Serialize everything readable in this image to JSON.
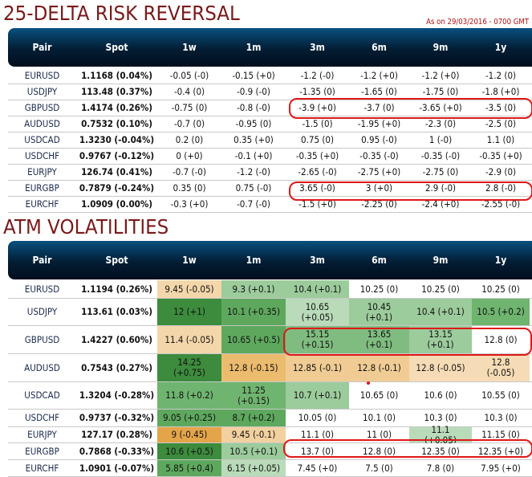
{
  "risk_reversal": {
    "title": "25-DELTA RISK REVERSAL",
    "as_of": "As on 29/03/2016 - 0700 GMT",
    "columns": [
      "Pair",
      "Spot",
      "1w",
      "1m",
      "3m",
      "6m",
      "9m",
      "1y"
    ],
    "rows": [
      [
        "EURUSD",
        "1.1168 (0.04%)",
        "-0.05 (-0)",
        "-0.15 (+0)",
        "-1.2 (-0)",
        "-1.2 (+0)",
        "-1.2 (+0)",
        "-1.2 (0)"
      ],
      [
        "USDJPY",
        "113.48 (0.37%)",
        "-0.4 (0)",
        "-0.9 (-0)",
        "-1.35 (0)",
        "-1.65 (0)",
        "-1.75 (0)",
        "-1.8 (+0)"
      ],
      [
        "GBPUSD",
        "1.4174 (0.26%)",
        "-0.75 (0)",
        "-0.8 (-0)",
        "-3.9 (+0)",
        "-3.7 (0)",
        "-3.65 (+0)",
        "-3.5 (0)"
      ],
      [
        "AUDUSD",
        "0.7532 (0.10%)",
        "-0.7 (0)",
        "-0.95 (0)",
        "-1.5 (0)",
        "-1.95 (+0)",
        "-2.3 (0)",
        "-2.5 (0)"
      ],
      [
        "USDCAD",
        "1.3230 (-0.04%)",
        "0.2 (0)",
        "0.35 (+0)",
        "0.75 (0)",
        "0.95 (-0)",
        "1 (-0)",
        "1.1 (0)"
      ],
      [
        "USDCHF",
        "0.9767 (-0.12%)",
        "0 (+0)",
        "-0.1 (+0)",
        "-0.35 (+0)",
        "-0.35 (-0)",
        "-0.35 (-0)",
        "-0.35 (+0)"
      ],
      [
        "EURJPY",
        "126.74 (0.41%)",
        "-0.7 (-0)",
        "-1.2 (-0)",
        "-2.65 (-0)",
        "-2.75 (+0)",
        "-2.75 (0)",
        "-2.9 (0)"
      ],
      [
        "EURGBP",
        "0.7879 (-0.24%)",
        "0.35 (0)",
        "0.75 (-0)",
        "3.65 (-0)",
        "3 (+0)",
        "2.9 (-0)",
        "2.8 (-0)"
      ],
      [
        "EURCHF",
        "1.0909 (0.00%)",
        "-0.3 (+0)",
        "-0.7 (-0)",
        "-1.5 (+0)",
        "-2.25 (0)",
        "-2.4 (+0)",
        "-2.55 (-0)"
      ]
    ]
  },
  "atm_volatilities": {
    "title": "ATM VOLATILITIES",
    "columns": [
      "Pair",
      "Spot",
      "1w",
      "1m",
      "3m",
      "6m",
      "9m",
      "1y"
    ],
    "rows": [
      [
        "EURUSD",
        "1.1194 (0.26%)",
        "9.45 (-0.05)",
        "9.3 (+0.1)",
        "10.4 (+0.1)",
        "10.25 (0)",
        "10.25 (0)",
        "10.25 (0)"
      ],
      [
        "USDJPY",
        "113.61 (0.03%)",
        "12 (+1)",
        "10.1 (+0.35)",
        "10.65 (+0.05)",
        "10.45 (+0.1)",
        "10.4 (+0.1)",
        "10.5 (+0.2)"
      ],
      [
        "GBPUSD",
        "1.4227 (0.60%)",
        "11.4 (-0.05)",
        "10.65 (+0.5)",
        "15.15 (+0.15)",
        "13.65 (+0.1)",
        "13.15 (+0.1)",
        "12.8 (0)"
      ],
      [
        "AUDUSD",
        "0.7543 (0.27%)",
        "14.25 (+0.75)",
        "12.8 (-0.15)",
        "12.85 (-0.1)",
        "12.8 (-0.1)",
        "12.8 (-0.05)",
        "12.8 (-0.05)"
      ],
      [
        "USDCAD",
        "1.3204 (-0.28%)",
        "11.8 (+0.2)",
        "11.25 (+0.15)",
        "10.7 (+0.1)",
        "10.65 (0)",
        "10.6 (0)",
        "10.55 (0)"
      ],
      [
        "USDCHF",
        "0.9737 (-0.32%)",
        "9.05 (+0.25)",
        "8.7 (+0.2)",
        "10.05 (0)",
        "10.1 (0)",
        "10.3 (0)",
        "10.3 (0)"
      ],
      [
        "EURJPY",
        "127.17 (0.28%)",
        "9 (-0.45)",
        "9.45 (-0.1)",
        "11.1 (0)",
        "11 (0)",
        "11.1 (+0.05)",
        "11.15 (0)"
      ],
      [
        "EURGBP",
        "0.7868 (-0.33%)",
        "10.6 (+0.5)",
        "10.5 (+0.1)",
        "13.7 (0)",
        "12.8 (0)",
        "12.35 (0)",
        "12.35 (+0)"
      ],
      [
        "EURCHF",
        "1.0901 (-0.07%)",
        "5.85 (+0.4)",
        "6.15 (+0.05)",
        "7.45 (+0)",
        "7.5 (0)",
        "7.8 (0)",
        "7.95 (+0)"
      ]
    ],
    "cell_colors": [
      [
        "#f3d6aa",
        "#9ccb9c",
        "#9ccb9c",
        "#ffffff",
        "#ffffff",
        "#ffffff"
      ],
      [
        "#3d8b3d",
        "#5ea85e",
        "#b9dbb9",
        "#9ccb9c",
        "#9ccb9c",
        "#6fb46f"
      ],
      [
        "#f3d6aa",
        "#5ea85e",
        "#80bc80",
        "#80bc80",
        "#9ccb9c",
        "#ffffff"
      ],
      [
        "#3d8b3d",
        "#ebbb6e",
        "#f0cc94",
        "#f0cc94",
        "#f5dcb6",
        "#f5dcb6"
      ],
      [
        "#6fb46f",
        "#6fb46f",
        "#9ccb9c",
        "#ffffff",
        "#ffffff",
        "#ffffff"
      ],
      [
        "#5ea85e",
        "#5ea85e",
        "#ffffff",
        "#ffffff",
        "#ffffff",
        "#ffffff"
      ],
      [
        "#e4a54a",
        "#f3d0a0",
        "#ffffff",
        "#ffffff",
        "#b9dbb9",
        "#ffffff"
      ],
      [
        "#3d8b3d",
        "#9ccb9c",
        "#ffffff",
        "#ffffff",
        "#ffffff",
        "#ffffff"
      ],
      [
        "#5ea85e",
        "#b9dbb9",
        "#ffffff",
        "#ffffff",
        "#ffffff",
        "#ffffff"
      ]
    ]
  },
  "highlight_color": "#e01818"
}
